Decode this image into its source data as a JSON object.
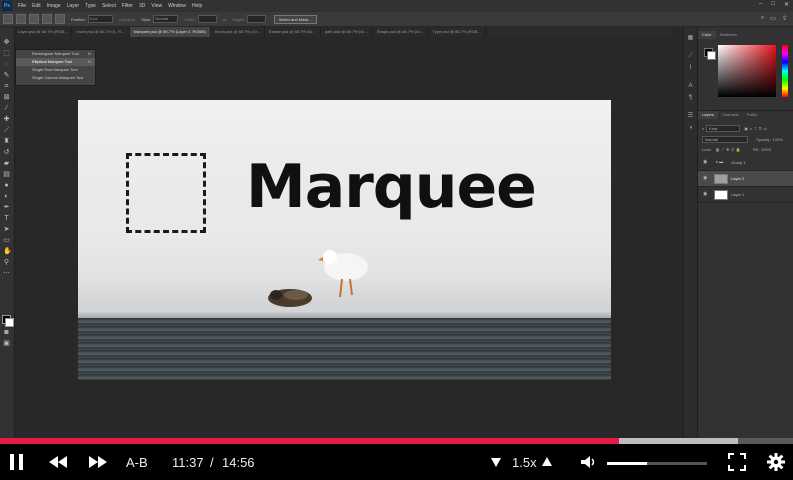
{
  "app": {
    "logo": "Ps",
    "menu": [
      "File",
      "Edit",
      "Image",
      "Layer",
      "Type",
      "Select",
      "Filter",
      "3D",
      "View",
      "Window",
      "Help"
    ]
  },
  "options_bar": {
    "feather_label": "Feather:",
    "feather_value": "0 px",
    "antialias_label": "Anti-alias",
    "style_label": "Style:",
    "style_value": "Normal",
    "width_label": "Width:",
    "height_label": "Height:",
    "select_mask_button": "Select and Mask..."
  },
  "tabs": [
    {
      "label": "Layer.psd @ 66.7% (RGB...",
      "active": false
    },
    {
      "label": "move.psd @ 66.7% (L. R...",
      "active": false
    },
    {
      "label": "Marquee.psd @ 66.7% (Layer 2, RGB/8)",
      "active": true
    },
    {
      "label": "brush.psd @ 66.7% (Gr...",
      "active": false
    },
    {
      "label": "Eraser.psd @ 66.7% (Gr...",
      "active": false
    },
    {
      "label": "path.psd @ 66.7% (Gr...",
      "active": false
    },
    {
      "label": "Shape.psd @ 66.7% (Gr...",
      "active": false
    },
    {
      "label": "Type.psd @ 66.7% (RGB...",
      "active": false
    }
  ],
  "flyout": [
    {
      "label": "Rectangular Marquee Tool",
      "shortcut": "M",
      "selected": false
    },
    {
      "label": "Elliptical Marquee Tool",
      "shortcut": "M",
      "selected": true
    },
    {
      "label": "Single Row Marquee Tool",
      "shortcut": "",
      "selected": false
    },
    {
      "label": "Single Column Marquee Tool",
      "shortcut": "",
      "selected": false
    }
  ],
  "canvas": {
    "title": "Marquee"
  },
  "panels": {
    "color_tabs": [
      "Color",
      "Swatches"
    ],
    "layer_tabs": [
      "Layers",
      "Channels",
      "Paths"
    ],
    "kind_label": "Kind",
    "blend_mode": "Normal",
    "opacity_label": "Opacity:",
    "opacity_value": "100%",
    "lock_label": "Lock:",
    "fill_label": "Fill:",
    "fill_value": "100%",
    "layers": [
      {
        "name": "Group 1",
        "selected": false
      },
      {
        "name": "Layer 2",
        "selected": true
      },
      {
        "name": "Layer 1",
        "selected": false
      }
    ]
  },
  "player": {
    "current_time": "11:37",
    "separator": "/",
    "total_time": "14:56",
    "ab_label": "A-B",
    "speed": "1.5x",
    "progress_fraction": 0.781,
    "buffered_fraction": 0.15,
    "volume_fraction": 0.4
  },
  "colors": {
    "progress": "#e11d48",
    "accent_red": "#e8131b"
  }
}
